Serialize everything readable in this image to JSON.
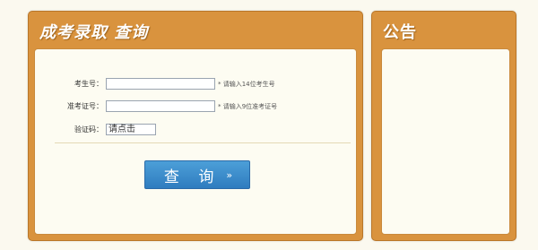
{
  "left_panel": {
    "title": "成考录取  查询",
    "form": {
      "exam_number_label": "考生号：",
      "exam_number_value": "",
      "exam_number_hint": "* 请输入14位考生号",
      "admission_ticket_label": "准考证号：",
      "admission_ticket_value": "",
      "admission_ticket_hint": "* 请输入9位准考证号",
      "captcha_label": "验证码：",
      "captcha_text": "请点击"
    },
    "query_button_label": "查 询",
    "query_button_icon": "»"
  },
  "right_panel": {
    "title": "公告"
  },
  "colors": {
    "panel_orange": "#d9933e",
    "panel_inner": "#fdfcf2",
    "button_blue": "#3a8bcb"
  }
}
